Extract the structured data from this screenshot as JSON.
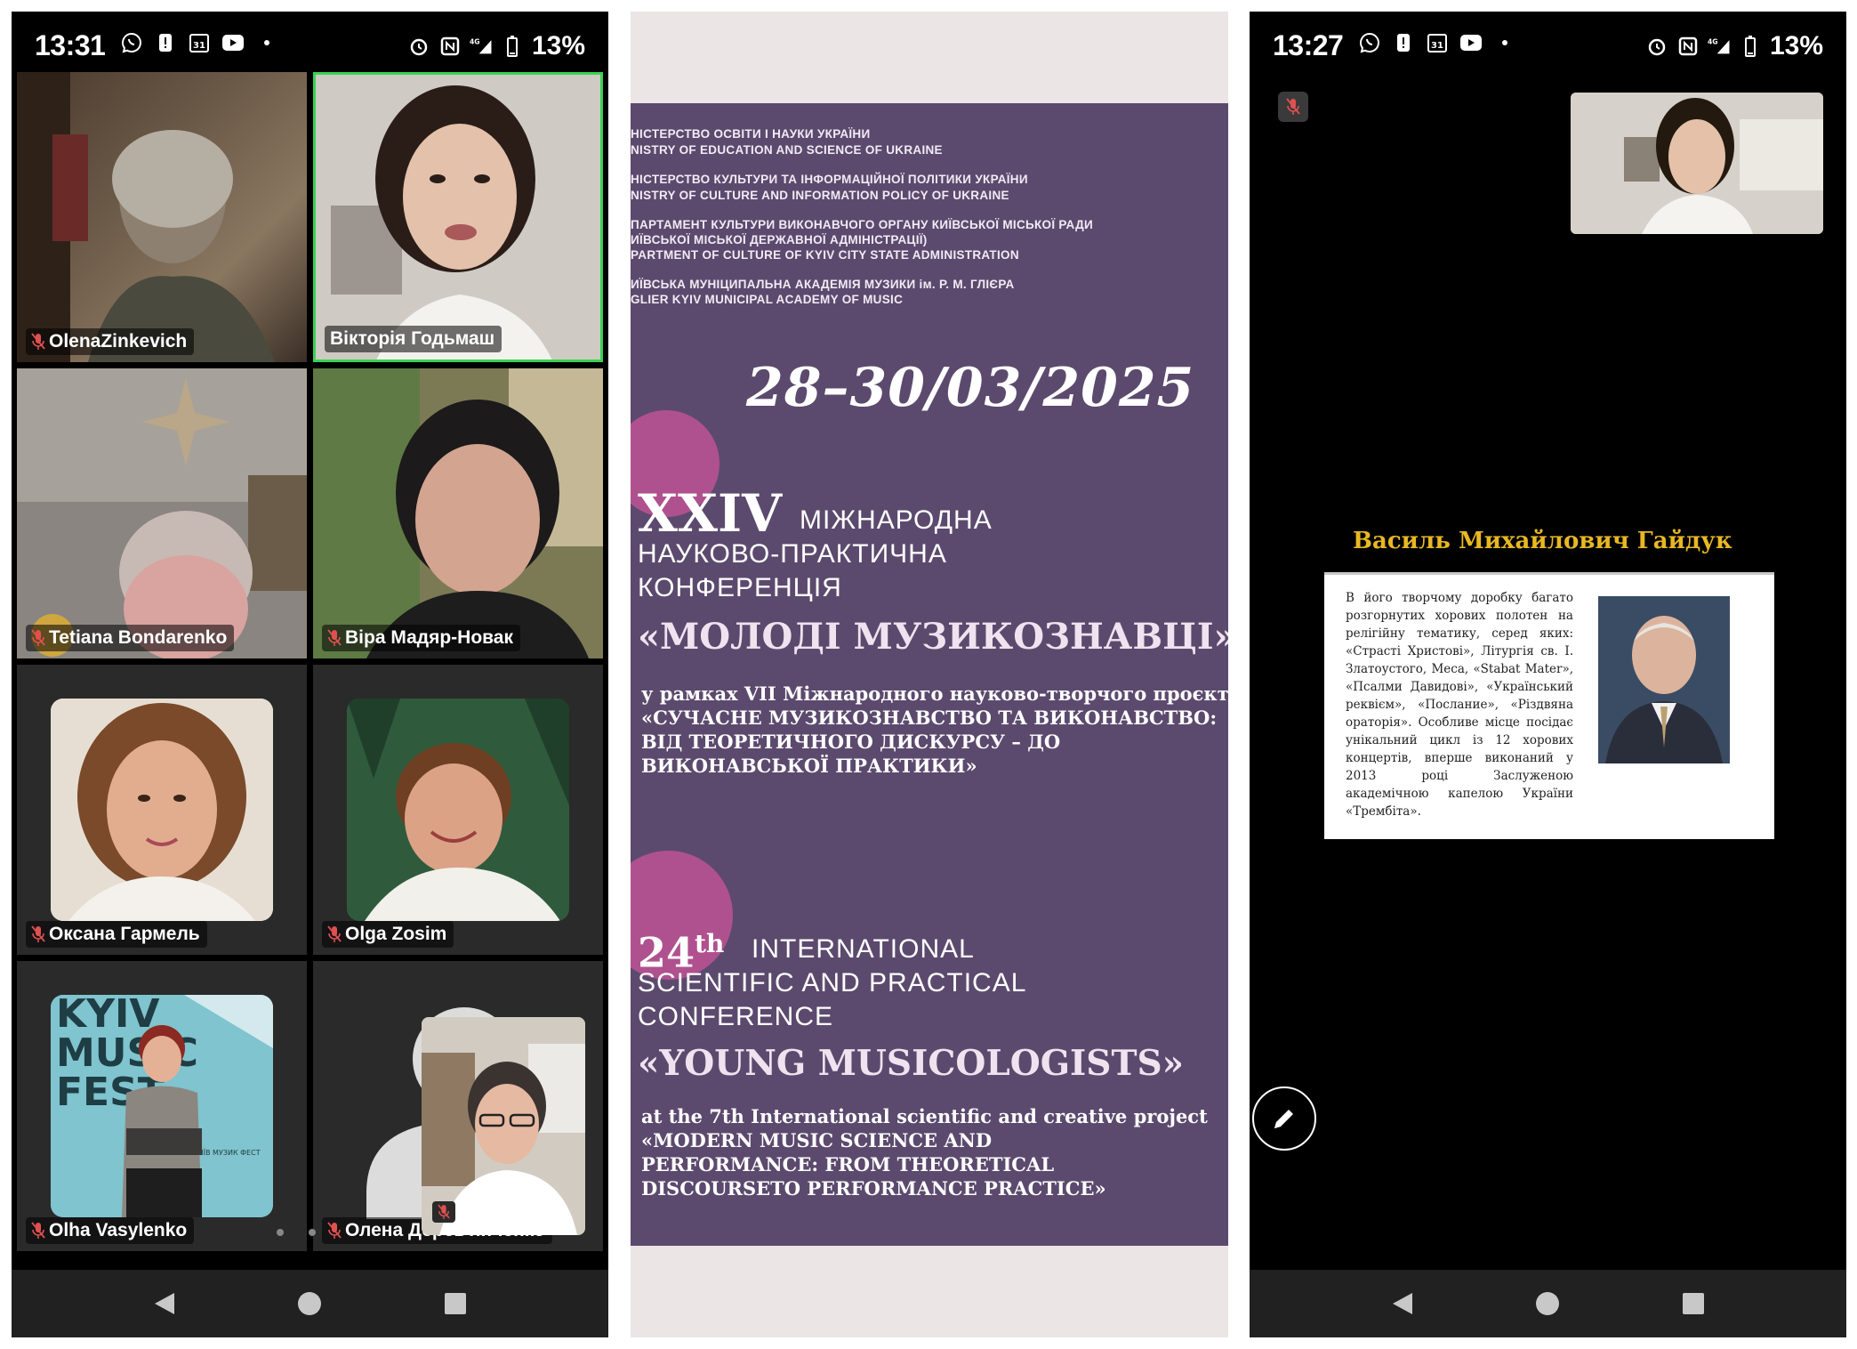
{
  "left_phone": {
    "status": {
      "time": "13:31",
      "network": "4G",
      "battery": "13%"
    },
    "participants": [
      {
        "name": "OlenaZinkevich",
        "muted": true,
        "active": false
      },
      {
        "name": "Вікторія Годьмаш",
        "muted": false,
        "active": true
      },
      {
        "name": "Tetiana Bondarenko",
        "muted": true,
        "active": false
      },
      {
        "name": "Віра Мадяр-Новак",
        "muted": true,
        "active": false
      },
      {
        "name": "Оксана Гармель",
        "muted": true,
        "active": false
      },
      {
        "name": "Olga Zosim",
        "muted": true,
        "active": false
      },
      {
        "name": "Olha Vasylenko",
        "muted": true,
        "active": false
      },
      {
        "name": "Олена Дерев'янченко",
        "muted": true,
        "active": false
      }
    ],
    "kyiv_logo": {
      "line1": "KYIV",
      "line2": "MUSIC",
      "line3": "FEST",
      "small": "КИЇВ МУЗИК ФЕСТ"
    }
  },
  "poster": {
    "org_lines": [
      "НІСТЕРСТВО ОСВІТИ І НАУКИ УКРАЇНИ",
      "NISTRY OF EDUCATION AND SCIENCE OF UKRAINE",
      "НІСТЕРСТВО КУЛЬТУРИ ТА ІНФОРМАЦІЙНОЇ ПОЛІТИКИ УКРАЇНИ",
      "NISTRY OF CULTURE AND INFORMATION POLICY OF UKRAINE",
      "ПАРТАМЕНТ КУЛЬТУРИ ВИКОНАВЧОГО ОРГАНУ КИЇВСЬКОЇ МІСЬКОЇ РАДИ",
      "ИЇВСЬКОЇ МІСЬКОЇ ДЕРЖАВНОЇ АДМІНІСТРАЦІЇ)",
      "PARTMENT OF CULTURE OF KYIV CITY STATE ADMINISTRATION",
      "ИЇВСЬКА МУНІЦИПАЛЬНА АКАДЕМІЯ МУЗИКИ ім. Р. М. ГЛІЄРА",
      "GLIER KYIV MUNICIPAL ACADEMY OF MUSIC"
    ],
    "dates": "28–30/03/2025",
    "ua_number": "XXIV",
    "ua_line1": "МІЖНАРОДНА",
    "ua_line2": "НАУКОВО-ПРАКТИЧНА",
    "ua_line3": "КОНФЕРЕНЦІЯ",
    "ua_title": "«МОЛОДІ МУЗИКОЗНАВЦІ»",
    "ua_project": [
      "у рамках VII Міжнародного науково-творчого проєкту",
      "«СУЧАСНЕ МУЗИКОЗНАВСТВО ТА ВИКОНАВСТВО:",
      "ВІД ТЕОРЕТИЧНОГО ДИСКУРСУ – ДО",
      "ВИКОНАВСЬКОЇ ПРАКТИКИ»"
    ],
    "en_number": "24",
    "en_sup": "th",
    "en_line1": "INTERNATIONAL",
    "en_line2": "SCIENTIFIC AND PRACTICAL",
    "en_line3": "CONFERENCE",
    "en_title": "«YOUNG MUSICOLOGISTS»",
    "en_project": [
      "at the 7th International scientific and creative project",
      "«MODERN MUSIC SCIENCE AND",
      "PERFORMANCE: FROM THEORETICAL",
      "DISCOURSETO PERFORMANCE PRACTICE»"
    ]
  },
  "right_phone": {
    "status": {
      "time": "13:27",
      "network": "4G",
      "battery": "13%"
    },
    "slide_title": "Василь Михайлович Гайдук",
    "slide_text": "В його творчому доробку багато розгорнутих хорових полотен на релігійну тематику, серед яких: «Страсті Христові», Літургія св. І. Златоустого, Меса, «Stabat Mater», «Псалми Давидові», «Український реквієм», «Послание», «Різдвяна ораторія». Особливе місце посідає унікальний цикл із 12 хорових концертів, вперше виконаний у 2013 році Заслуженою академічною капелою України «Трембіта»."
  },
  "colors": {
    "active_border": "#39d353",
    "poster_bg": "#5c4a6e",
    "poster_accent": "#b0518f",
    "slide_title": "#e8b824",
    "navbar": "#212121"
  },
  "icons": [
    "mic-off-icon",
    "back-icon",
    "home-icon",
    "recents-icon",
    "pen-icon",
    "battery-icon",
    "signal-icon",
    "alarm-icon",
    "nfc-icon"
  ]
}
